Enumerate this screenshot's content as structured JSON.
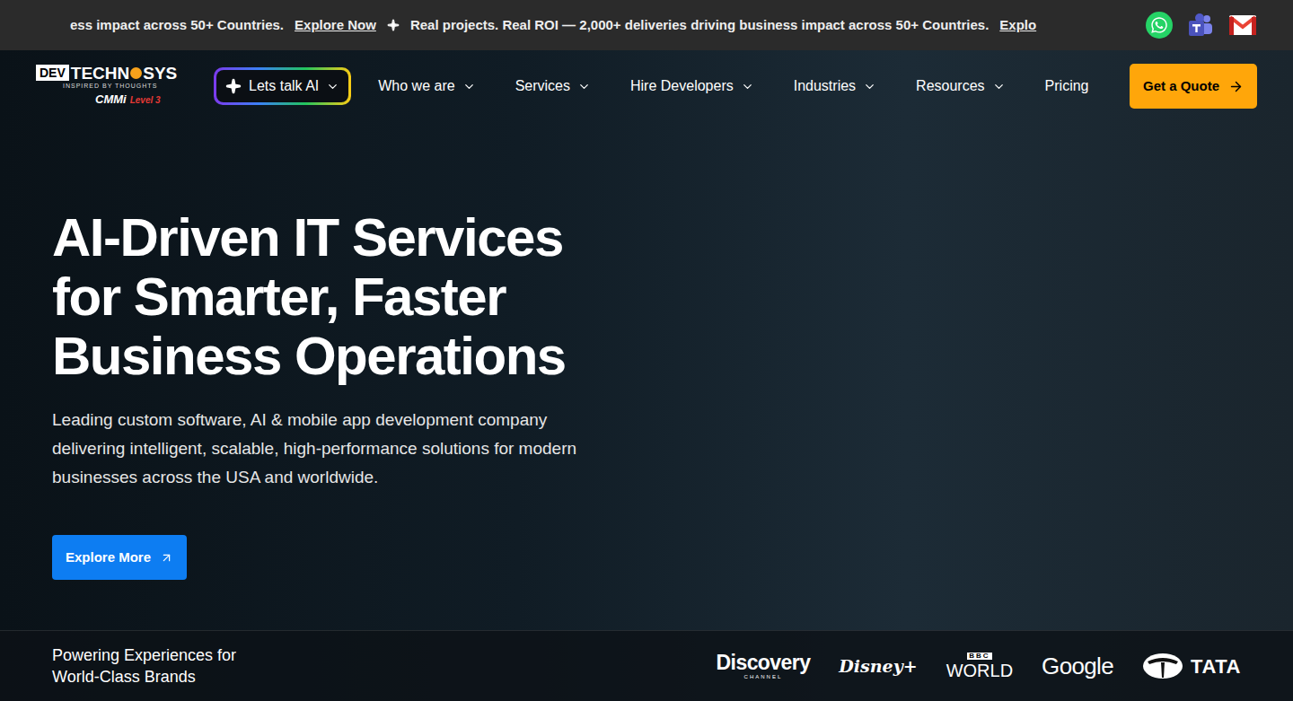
{
  "ticker": {
    "segments": [
      {
        "text": "ess impact across 50+ Countries.",
        "link": "Explore Now"
      },
      {
        "text": "Real projects. Real ROI — 2,000+ deliveries driving business impact across 50+ Countries.",
        "link": "Explo"
      }
    ]
  },
  "logo": {
    "box": "DEV",
    "left": "TECHN",
    "right": "SYS",
    "tagline": "INSPIRED BY THOUGHTS",
    "cmmi": "CMMi",
    "level": "Level 3"
  },
  "ai_button": {
    "label": "Lets talk AI"
  },
  "nav": [
    {
      "label": "Who we are",
      "dropdown": true
    },
    {
      "label": "Services",
      "dropdown": true
    },
    {
      "label": "Hire Developers",
      "dropdown": true
    },
    {
      "label": "Industries",
      "dropdown": true
    },
    {
      "label": "Resources",
      "dropdown": true
    },
    {
      "label": "Pricing",
      "dropdown": false
    }
  ],
  "cta": {
    "label": "Get a Quote"
  },
  "hero": {
    "title_lines": [
      "AI-Driven IT Services",
      "for Smarter, Faster",
      "Business Operations"
    ],
    "subtitle": "Leading custom software, AI & mobile app development company delivering intelligent, scalable, high-performance solutions for modern businesses across the USA and worldwide.",
    "button": "Explore More"
  },
  "brands_strip": {
    "heading_lines": [
      "Powering Experiences for",
      "World-Class Brands"
    ],
    "brands": [
      {
        "kind": "discovery",
        "name": "Discovery",
        "sub": "CHANNEL"
      },
      {
        "kind": "disney",
        "name": "Disney+"
      },
      {
        "kind": "bbc",
        "name": "WORLD",
        "sup": "BBC"
      },
      {
        "kind": "google",
        "name": "Google"
      },
      {
        "kind": "tata",
        "name": "TATA"
      }
    ]
  }
}
